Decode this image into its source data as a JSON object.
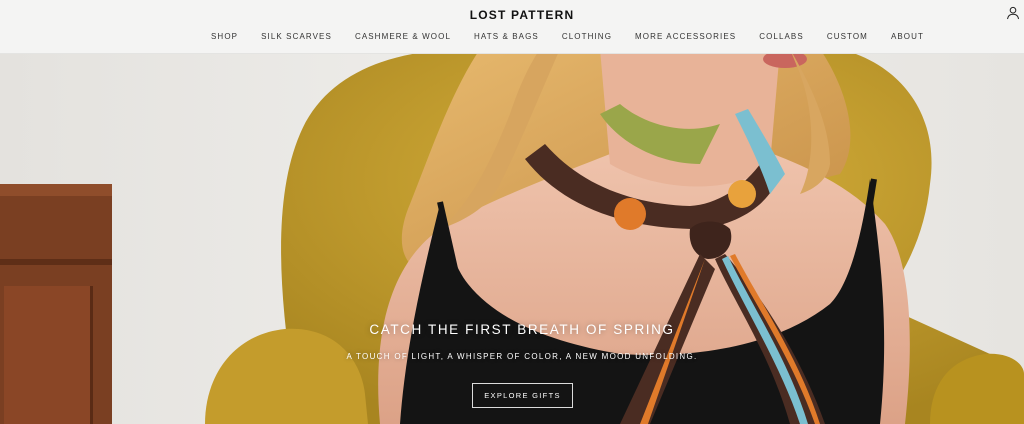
{
  "header": {
    "brand": "LOST PATTERN",
    "account_icon": "user-icon",
    "nav": [
      {
        "label": "SHOP"
      },
      {
        "label": "SILK SCARVES"
      },
      {
        "label": "CASHMERE & WOOL"
      },
      {
        "label": "HATS & BAGS"
      },
      {
        "label": "CLOTHING"
      },
      {
        "label": "MORE ACCESSORIES"
      },
      {
        "label": "COLLABS"
      },
      {
        "label": "CUSTOM"
      },
      {
        "label": "ABOUT"
      }
    ]
  },
  "hero": {
    "title": "CATCH THE FIRST BREATH OF SPRING",
    "subtitle": "A TOUCH OF LIGHT, A WHISPER OF COLOR, A NEW MOOD UNFOLDING.",
    "cta_label": "EXPLORE GIFTS"
  },
  "colors": {
    "header_bg": "#f4f4f3",
    "chair": "#c9a22f",
    "top": "#141414",
    "skin": "#e9b39b",
    "hair": "#d9a45d",
    "scarf_brown": "#4a2c22",
    "scarf_blue": "#7bbfd0",
    "scarf_orange": "#e07a2a"
  }
}
